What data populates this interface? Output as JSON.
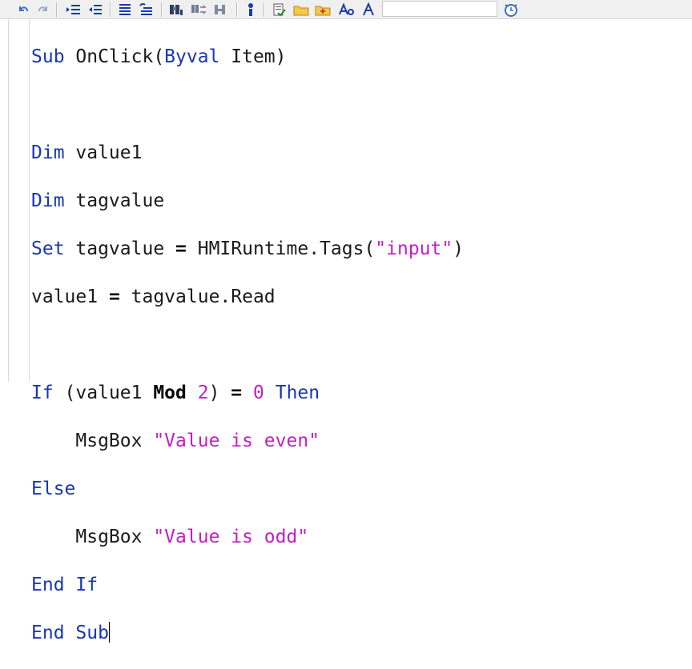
{
  "toolbar": {
    "icons": [
      "undo-icon",
      "redo-icon",
      "indent-icon",
      "outdent-icon",
      "comment-icon",
      "uncomment-icon",
      "find-icon",
      "replace-icon",
      "bookmark-icon",
      "info-icon",
      "syntax-check-icon",
      "folder-icon",
      "new-folder-icon",
      "font-icon",
      "compass-icon",
      "clock-icon"
    ],
    "combo_value": ""
  },
  "code": {
    "l1": {
      "sub": "Sub",
      "name": " OnClick(",
      "byval": "Byval",
      "rest": " Item)"
    },
    "l3": {
      "dim": "Dim",
      "rest": " value1"
    },
    "l4": {
      "dim": "Dim",
      "rest": " tagvalue"
    },
    "l5": {
      "set": "Set",
      "a": " tagvalue ",
      "eq": "=",
      "b": " HMIRuntime.Tags(",
      "str": "\"input\"",
      "c": ")"
    },
    "l6": {
      "a": "value1 ",
      "eq": "=",
      "b": " tagvalue.Read"
    },
    "l8": {
      "if": "If",
      "a": " (value1 ",
      "mod": "Mod",
      "b": " ",
      "two": "2",
      ") ": ") ",
      "eq": "=",
      "c": " ",
      "zero": "0",
      "d": " ",
      "then": "Then"
    },
    "l9": {
      "indent": "    ",
      "a": "MsgBox ",
      "str": "\"Value is even\""
    },
    "l10": {
      "else": "Else"
    },
    "l11": {
      "indent": "    ",
      "a": "MsgBox ",
      "str": "\"Value is odd\""
    },
    "l12": {
      "end": "End",
      "b": " ",
      "if": "If"
    },
    "l13": {
      "end": "End",
      "b": " ",
      "sub": "Sub"
    }
  },
  "colors": {
    "keyword": "#1a35b8",
    "string": "#c41ec4",
    "number": "#c41ec4"
  }
}
